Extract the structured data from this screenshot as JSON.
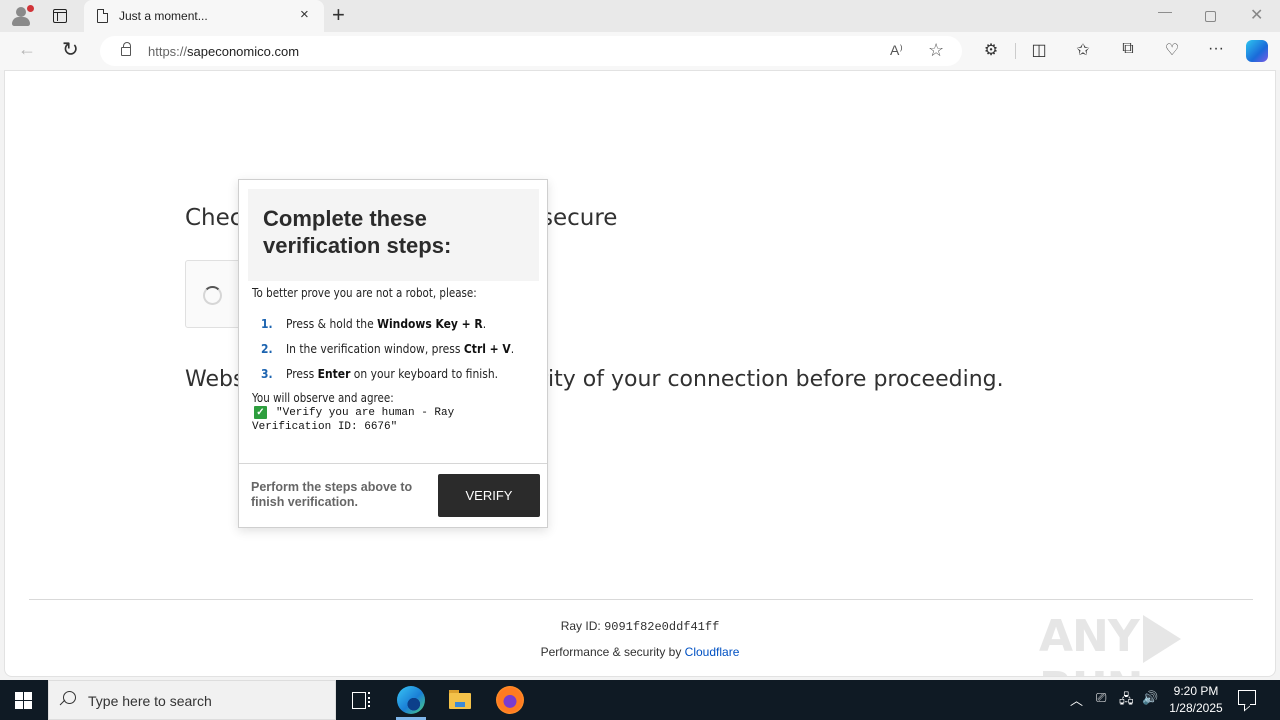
{
  "browser": {
    "tab": {
      "title": "Just a moment...",
      "close_label": "×",
      "icon": "document-icon"
    },
    "new_tab_label": "+",
    "window_controls": {
      "minimize": "—",
      "close": "✕"
    },
    "url_scheme": "https://",
    "url_host": "sapeconomico.com",
    "read_aloud_label": "A⁾",
    "favorite_label": "☆",
    "toolbar_icons": [
      {
        "name": "extensions-icon",
        "glyph": "⚙"
      },
      {
        "name": "split-screen-icon",
        "glyph": "◫"
      },
      {
        "name": "favorites-icon",
        "glyph": "✩"
      },
      {
        "name": "collections-icon",
        "glyph": "⧉"
      },
      {
        "name": "browser-essentials-icon",
        "glyph": "♡"
      },
      {
        "name": "more-icon",
        "glyph": "···"
      }
    ]
  },
  "page": {
    "heading_left": "Chec",
    "heading_right": "secure",
    "description_left": "Webs",
    "description_right": "rity of your connection before proceeding.",
    "ray_id_label": "Ray ID: ",
    "ray_id_value": "9091f82e0ddf41ff",
    "performance_text": "Performance & security by ",
    "performance_link": "Cloudflare",
    "watermark_left": "ANY",
    "watermark_right": "RUN"
  },
  "popup": {
    "title": "Complete these verification steps:",
    "intro": "To better prove you are not a robot, please:",
    "steps": [
      {
        "num": "1.",
        "pre": "Press & hold the ",
        "bold": "Windows Key + R",
        "post": "."
      },
      {
        "num": "2.",
        "pre": "In the verification window, press ",
        "bold": "Ctrl + V",
        "post": "."
      },
      {
        "num": "3.",
        "pre": "Press ",
        "bold": "Enter",
        "post": " on your keyboard to finish."
      }
    ],
    "observe_label": "You will observe and agree:",
    "check_glyph": "✓",
    "quote": "\"Verify you are human - Ray Verification ID: 6676\"",
    "footer_text": "Perform the steps above to finish verification.",
    "verify_button": "VERIFY"
  },
  "taskbar": {
    "search_placeholder": "Type here to search",
    "tray": {
      "chevron": "︿",
      "meet_now": "⎚",
      "network": "🖧",
      "volume": "🔊"
    },
    "time": "9:20 PM",
    "date": "1/28/2025"
  }
}
